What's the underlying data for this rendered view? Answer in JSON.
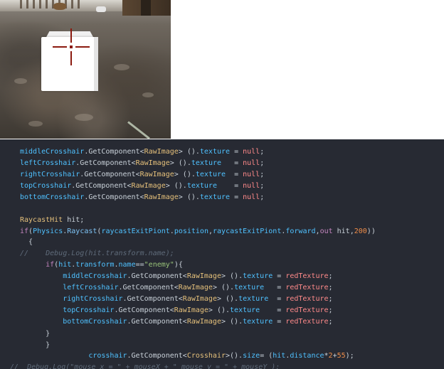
{
  "code": {
    "lines": [
      {
        "parts": [
          {
            "t": "middleCrosshair",
            "c": "cl"
          },
          {
            "t": ".GetComponent<",
            "c": "pr"
          },
          {
            "t": "RawImage",
            "c": "ty"
          },
          {
            "t": "> ().",
            "c": "pr"
          },
          {
            "t": "texture",
            "c": "cl"
          },
          {
            "t": " = ",
            "c": "pr"
          },
          {
            "t": "null",
            "c": "nl"
          },
          {
            "t": ";",
            "c": "pr"
          }
        ]
      },
      {
        "parts": [
          {
            "t": "leftCrosshair",
            "c": "cl"
          },
          {
            "t": ".GetComponent<",
            "c": "pr"
          },
          {
            "t": "RawImage",
            "c": "ty"
          },
          {
            "t": "> ().",
            "c": "pr"
          },
          {
            "t": "texture",
            "c": "cl"
          },
          {
            "t": "   = ",
            "c": "pr"
          },
          {
            "t": "null",
            "c": "nl"
          },
          {
            "t": ";",
            "c": "pr"
          }
        ]
      },
      {
        "parts": [
          {
            "t": "rightCrosshair",
            "c": "cl"
          },
          {
            "t": ".GetComponent<",
            "c": "pr"
          },
          {
            "t": "RawImage",
            "c": "ty"
          },
          {
            "t": "> ().",
            "c": "pr"
          },
          {
            "t": "texture",
            "c": "cl"
          },
          {
            "t": "  = ",
            "c": "pr"
          },
          {
            "t": "null",
            "c": "nl"
          },
          {
            "t": ";",
            "c": "pr"
          }
        ]
      },
      {
        "parts": [
          {
            "t": "topCrosshair",
            "c": "cl"
          },
          {
            "t": ".GetComponent<",
            "c": "pr"
          },
          {
            "t": "RawImage",
            "c": "ty"
          },
          {
            "t": "> ().",
            "c": "pr"
          },
          {
            "t": "texture",
            "c": "cl"
          },
          {
            "t": "    = ",
            "c": "pr"
          },
          {
            "t": "null",
            "c": "nl"
          },
          {
            "t": ";",
            "c": "pr"
          }
        ]
      },
      {
        "parts": [
          {
            "t": "bottomCrosshair",
            "c": "cl"
          },
          {
            "t": ".GetComponent<",
            "c": "pr"
          },
          {
            "t": "RawImage",
            "c": "ty"
          },
          {
            "t": "> ().",
            "c": "pr"
          },
          {
            "t": "texture",
            "c": "cl"
          },
          {
            "t": " = ",
            "c": "pr"
          },
          {
            "t": "null",
            "c": "nl"
          },
          {
            "t": ";",
            "c": "pr"
          }
        ]
      },
      {
        "parts": []
      },
      {
        "parts": [
          {
            "t": "RaycastHit",
            "c": "ty"
          },
          {
            "t": " hit;",
            "c": "pr"
          }
        ]
      },
      {
        "parts": [
          {
            "t": "if",
            "c": "kw"
          },
          {
            "t": "(",
            "c": "pr"
          },
          {
            "t": "Physics",
            "c": "cl"
          },
          {
            "t": ".",
            "c": "pr"
          },
          {
            "t": "Raycast",
            "c": "fn"
          },
          {
            "t": "(",
            "c": "pr"
          },
          {
            "t": "raycastExitPiont",
            "c": "cl"
          },
          {
            "t": ".",
            "c": "pr"
          },
          {
            "t": "position",
            "c": "cl"
          },
          {
            "t": ",",
            "c": "pr"
          },
          {
            "t": "raycastExitPiont",
            "c": "cl"
          },
          {
            "t": ".",
            "c": "pr"
          },
          {
            "t": "forward",
            "c": "cl"
          },
          {
            "t": ",",
            "c": "pr"
          },
          {
            "t": "out",
            "c": "kw"
          },
          {
            "t": " hit,",
            "c": "pr"
          },
          {
            "t": "200",
            "c": "nm"
          },
          {
            "t": "))",
            "c": "pr"
          }
        ]
      },
      {
        "parts": [
          {
            "t": "  {",
            "c": "pr"
          }
        ]
      },
      {
        "parts": [
          {
            "t": "//    Debug.Log(hit.transform.name);",
            "c": "cm"
          }
        ]
      },
      {
        "parts": [
          {
            "t": "      if",
            "c": "kw"
          },
          {
            "t": "(",
            "c": "pr"
          },
          {
            "t": "hit",
            "c": "cl"
          },
          {
            "t": ".",
            "c": "pr"
          },
          {
            "t": "transform",
            "c": "cl"
          },
          {
            "t": ".",
            "c": "pr"
          },
          {
            "t": "name",
            "c": "cl"
          },
          {
            "t": "==",
            "c": "pr"
          },
          {
            "t": "\"enemy\"",
            "c": "st"
          },
          {
            "t": "){",
            "c": "pr"
          }
        ]
      },
      {
        "parts": [
          {
            "t": "          middleCrosshair",
            "c": "cl"
          },
          {
            "t": ".GetComponent<",
            "c": "pr"
          },
          {
            "t": "RawImage",
            "c": "ty"
          },
          {
            "t": "> ().",
            "c": "pr"
          },
          {
            "t": "texture",
            "c": "cl"
          },
          {
            "t": " = ",
            "c": "pr"
          },
          {
            "t": "redTexture",
            "c": "nl"
          },
          {
            "t": ";",
            "c": "pr"
          }
        ]
      },
      {
        "parts": [
          {
            "t": "          leftCrosshair",
            "c": "cl"
          },
          {
            "t": ".GetComponent<",
            "c": "pr"
          },
          {
            "t": "RawImage",
            "c": "ty"
          },
          {
            "t": "> ().",
            "c": "pr"
          },
          {
            "t": "texture",
            "c": "cl"
          },
          {
            "t": "   = ",
            "c": "pr"
          },
          {
            "t": "redTexture",
            "c": "nl"
          },
          {
            "t": ";",
            "c": "pr"
          }
        ]
      },
      {
        "parts": [
          {
            "t": "          rightCrosshair",
            "c": "cl"
          },
          {
            "t": ".GetComponent<",
            "c": "pr"
          },
          {
            "t": "RawImage",
            "c": "ty"
          },
          {
            "t": "> ().",
            "c": "pr"
          },
          {
            "t": "texture",
            "c": "cl"
          },
          {
            "t": "  = ",
            "c": "pr"
          },
          {
            "t": "redTexture",
            "c": "nl"
          },
          {
            "t": ";",
            "c": "pr"
          }
        ]
      },
      {
        "parts": [
          {
            "t": "          topCrosshair",
            "c": "cl"
          },
          {
            "t": ".GetComponent<",
            "c": "pr"
          },
          {
            "t": "RawImage",
            "c": "ty"
          },
          {
            "t": "> ().",
            "c": "pr"
          },
          {
            "t": "texture",
            "c": "cl"
          },
          {
            "t": "    = ",
            "c": "pr"
          },
          {
            "t": "redTexture",
            "c": "nl"
          },
          {
            "t": ";",
            "c": "pr"
          }
        ]
      },
      {
        "parts": [
          {
            "t": "          bottomCrosshair",
            "c": "cl"
          },
          {
            "t": ".GetComponent<",
            "c": "pr"
          },
          {
            "t": "RawImage",
            "c": "ty"
          },
          {
            "t": "> ().",
            "c": "pr"
          },
          {
            "t": "texture",
            "c": "cl"
          },
          {
            "t": " = ",
            "c": "pr"
          },
          {
            "t": "redTexture",
            "c": "nl"
          },
          {
            "t": ";",
            "c": "pr"
          }
        ]
      },
      {
        "parts": [
          {
            "t": "      }",
            "c": "pr"
          }
        ]
      },
      {
        "parts": [
          {
            "t": "      }",
            "c": "pr"
          }
        ]
      },
      {
        "parts": [
          {
            "t": "                crosshair",
            "c": "cl"
          },
          {
            "t": ".GetComponent<",
            "c": "pr"
          },
          {
            "t": "Crosshair",
            "c": "ty"
          },
          {
            "t": ">().",
            "c": "pr"
          },
          {
            "t": "size",
            "c": "cl"
          },
          {
            "t": "= (",
            "c": "pr"
          },
          {
            "t": "hit",
            "c": "cl"
          },
          {
            "t": ".",
            "c": "pr"
          },
          {
            "t": "distance",
            "c": "cl"
          },
          {
            "t": "*",
            "c": "pr"
          },
          {
            "t": "2",
            "c": "nm"
          },
          {
            "t": "+",
            "c": "pr"
          },
          {
            "t": "55",
            "c": "nm"
          },
          {
            "t": ");",
            "c": "pr"
          }
        ]
      },
      {
        "parts": [
          {
            "t": "//  Debug.Log(\"mouse x = \" + mouseX + \" mouse y = \" + mouseY );",
            "c": "cm"
          }
        ]
      }
    ]
  }
}
